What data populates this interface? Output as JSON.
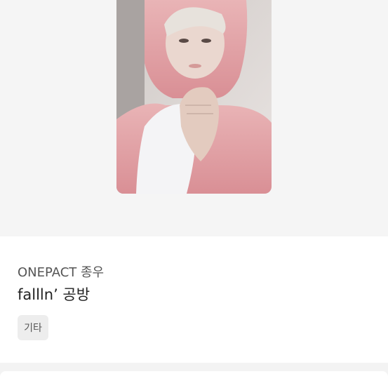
{
  "product": {
    "artist": "ONEPACT 종우",
    "title": "fallln’ 공방",
    "tag": "기타"
  }
}
